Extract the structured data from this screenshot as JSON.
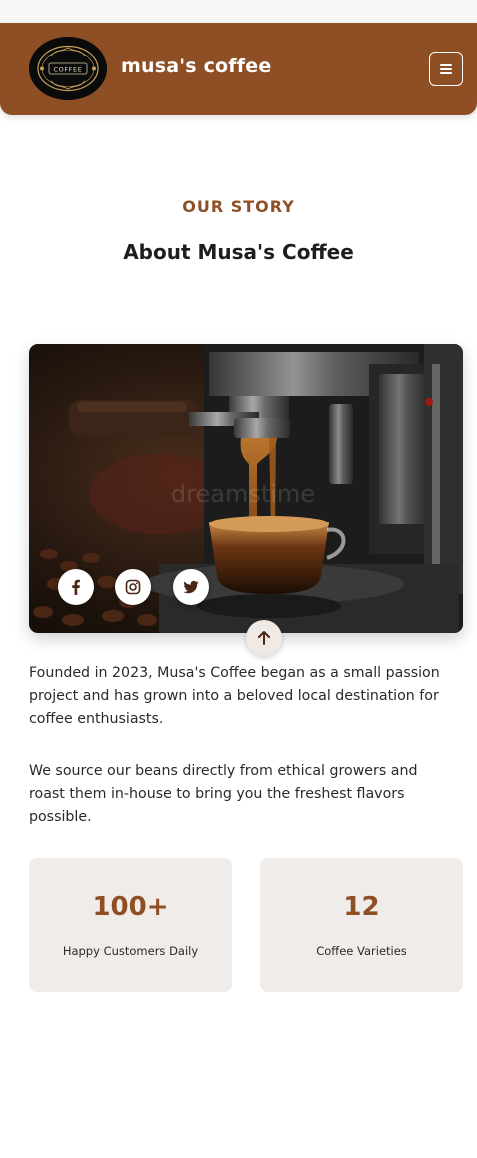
{
  "header": {
    "brand": "musa's coffee",
    "logo_text": "COFFEE",
    "logo_icon": "coffee-logo-icon",
    "menu_icon": "hamburger-menu-icon",
    "background": "#8f4f25"
  },
  "about": {
    "eyebrow": "OUR STORY",
    "title": "About Musa's Coffee",
    "image_watermark": "dreamstime",
    "paragraphs": [
      "Founded in 2023, Musa's Coffee began as a small passion project and has grown into a beloved local destination for coffee enthusiasts.",
      "We source our beans directly from ethical growers and roast them in-house to bring you the freshest flavors possible."
    ]
  },
  "social": [
    {
      "icon": "facebook-icon"
    },
    {
      "icon": "instagram-icon"
    },
    {
      "icon": "twitter-icon"
    }
  ],
  "scroll_top_icon": "arrow-up-icon",
  "stats": [
    {
      "value": "100+",
      "label": "Happy Customers Daily"
    },
    {
      "value": "12",
      "label": "Coffee Varieties"
    }
  ],
  "colors": {
    "accent": "#8f4f25",
    "card": "#efecea"
  }
}
